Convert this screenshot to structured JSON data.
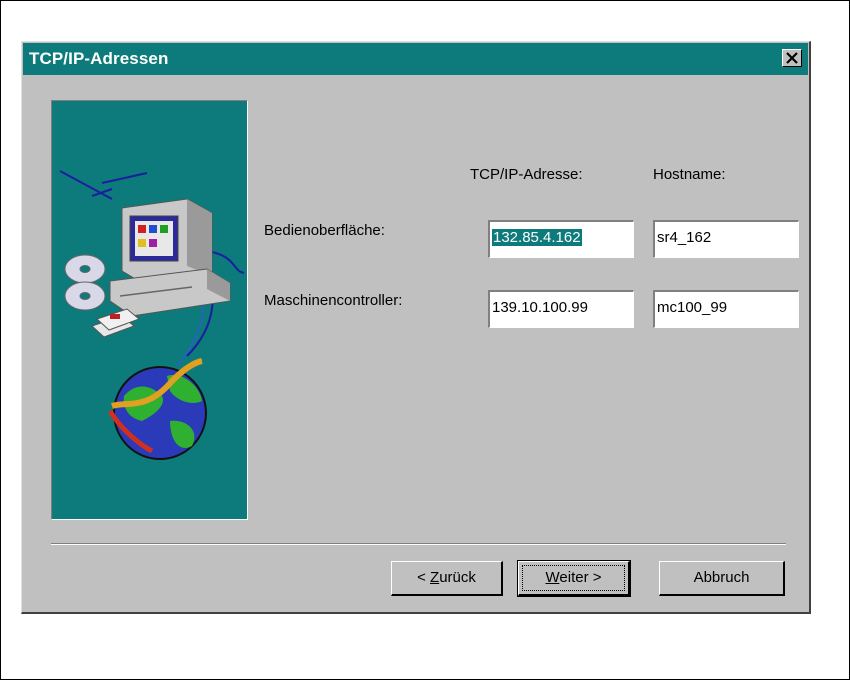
{
  "dialog": {
    "title": "TCP/IP-Adressen",
    "close_label": "×"
  },
  "form": {
    "col_address": "TCP/IP-Adresse:",
    "col_hostname": "Hostname:",
    "rows": [
      {
        "label": "Bedienoberfläche:",
        "address": "132.85.4.162",
        "hostname": "sr4_162",
        "address_selected": true
      },
      {
        "label": "Maschinencontroller:",
        "address": "139.10.100.99",
        "hostname": "mc100_99",
        "address_selected": false
      }
    ]
  },
  "buttons": {
    "back_prefix": "< ",
    "back_accel": "Z",
    "back_rest": "urück",
    "next_accel": "W",
    "next_rest": "eiter >",
    "cancel": "Abbruch"
  },
  "colors": {
    "titlebar": "#0d7b7b",
    "illustration_bg": "#0d7b7b",
    "dialog_bg": "#c0c0c0"
  },
  "icons": [
    "close-icon",
    "computer-icon",
    "cd-icon",
    "floppy-icon",
    "globe-icon",
    "network-cable-icon"
  ]
}
